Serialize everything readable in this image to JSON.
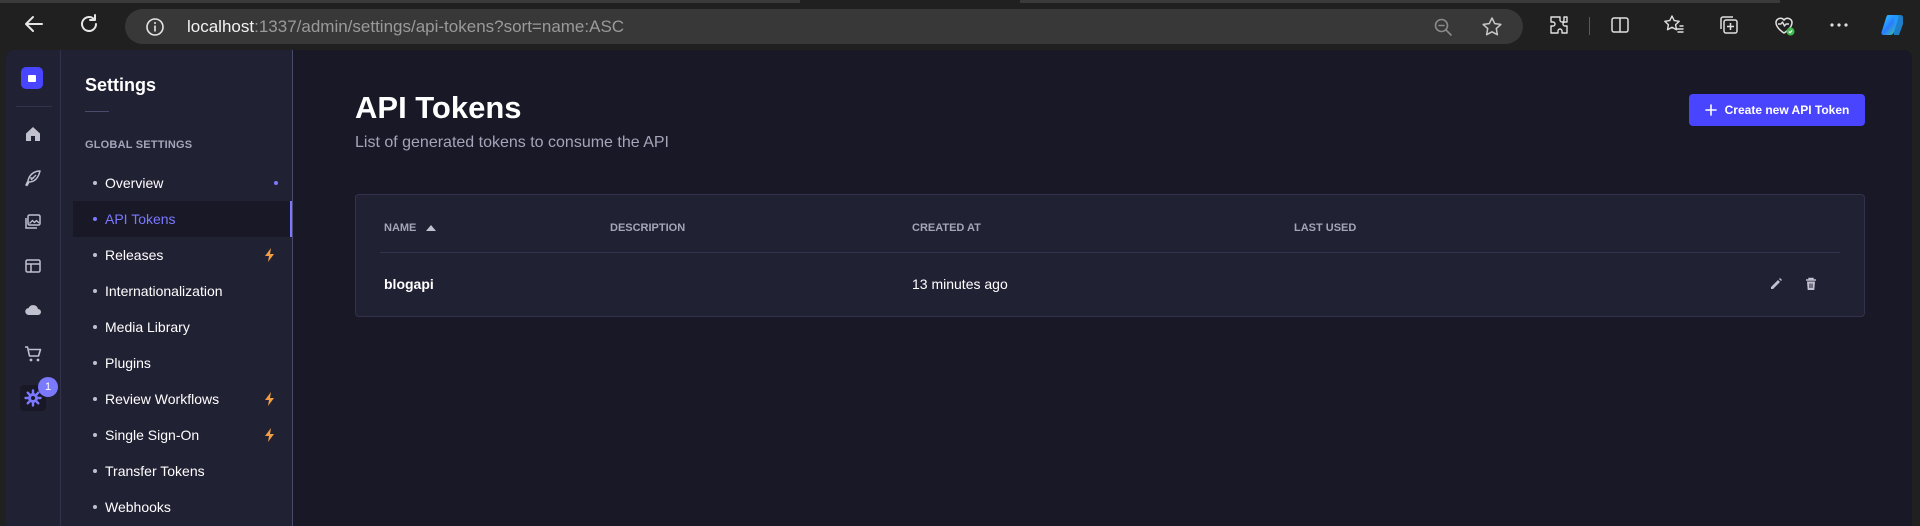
{
  "browser": {
    "url_host": "localhost",
    "url_rest": ":1337/admin/settings/api-tokens?sort=name:ASC"
  },
  "main_nav": {
    "badge_count": "1",
    "icons": [
      "home-icon",
      "feather-icon",
      "images-icon",
      "layout-icon",
      "cloud-icon",
      "cart-icon",
      "settings-gear-icon"
    ]
  },
  "sub_nav": {
    "title": "Settings",
    "section_label": "GLOBAL SETTINGS",
    "items": [
      {
        "label": "Overview"
      },
      {
        "label": "API Tokens"
      },
      {
        "label": "Releases"
      },
      {
        "label": "Internationalization"
      },
      {
        "label": "Media Library"
      },
      {
        "label": "Plugins"
      },
      {
        "label": "Review Workflows"
      },
      {
        "label": "Single Sign-On"
      },
      {
        "label": "Transfer Tokens"
      },
      {
        "label": "Webhooks"
      }
    ]
  },
  "page": {
    "title": "API Tokens",
    "subtitle": "List of generated tokens to consume the API",
    "create_button_label": "Create new API Token"
  },
  "table": {
    "headers": {
      "name": "NAME",
      "description": "DESCRIPTION",
      "created_at": "CREATED AT",
      "last_used": "LAST USED"
    },
    "rows": [
      {
        "name": "blogapi",
        "description": "",
        "created_at": "13 minutes ago",
        "last_used": ""
      }
    ]
  },
  "colors": {
    "accent": "#4945ff",
    "accent_light": "#7b79ff",
    "bolt": "#f29d41",
    "background": "#181826",
    "panel": "#212134"
  }
}
